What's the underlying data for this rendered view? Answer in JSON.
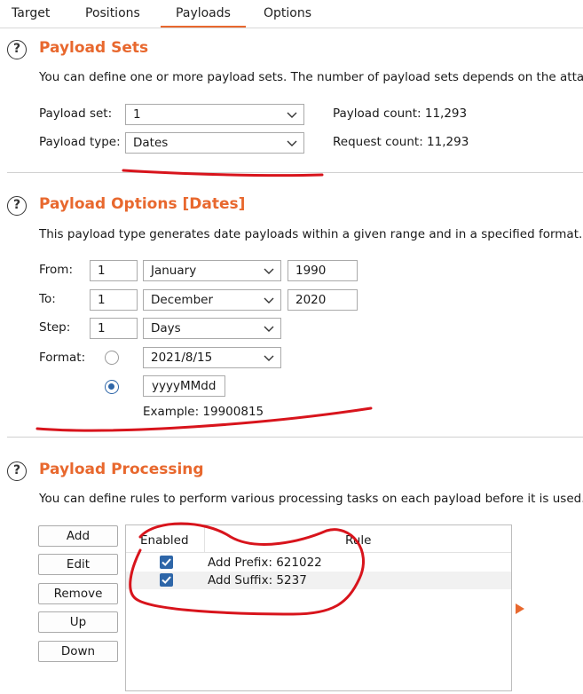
{
  "tabs": [
    "Target",
    "Positions",
    "Payloads",
    "Options"
  ],
  "active_tab": "Payloads",
  "payload_sets": {
    "title": "Payload Sets",
    "description": "You can define one or more payload sets. The number of payload sets depends on the attac",
    "set_label": "Payload set:",
    "set_value": "1",
    "type_label": "Payload type:",
    "type_value": "Dates",
    "count_label": "Payload count: 11,293",
    "request_label": "Request count: 11,293"
  },
  "payload_options": {
    "title": "Payload Options [Dates]",
    "description": "This payload type generates date payloads within a given range and in a specified format.",
    "from_label": "From:",
    "from_day": "1",
    "from_month": "January",
    "from_year": "1990",
    "to_label": "To:",
    "to_day": "1",
    "to_month": "December",
    "to_year": "2020",
    "step_label": "Step:",
    "step_value": "1",
    "step_unit": "Days",
    "format_label": "Format:",
    "format_preset": "2021/8/15",
    "format_custom": "yyyyMMdd",
    "example": "Example: 19900815"
  },
  "payload_processing": {
    "title": "Payload Processing",
    "description": "You can define rules to perform various processing tasks on each payload before it is used.",
    "buttons": [
      "Add",
      "Edit",
      "Remove",
      "Up",
      "Down"
    ],
    "columns": [
      "Enabled",
      "Rule"
    ],
    "rows": [
      {
        "enabled": true,
        "rule": "Add Prefix: 621022"
      },
      {
        "enabled": true,
        "rule": "Add Suffix: 5237"
      }
    ]
  },
  "colors": {
    "accent": "#e8682e",
    "annotation": "#d8141c",
    "checkbox": "#2e66a8"
  },
  "icons": [
    "help-icon",
    "chevron-down-icon",
    "check-icon",
    "expand-arrow-icon"
  ]
}
